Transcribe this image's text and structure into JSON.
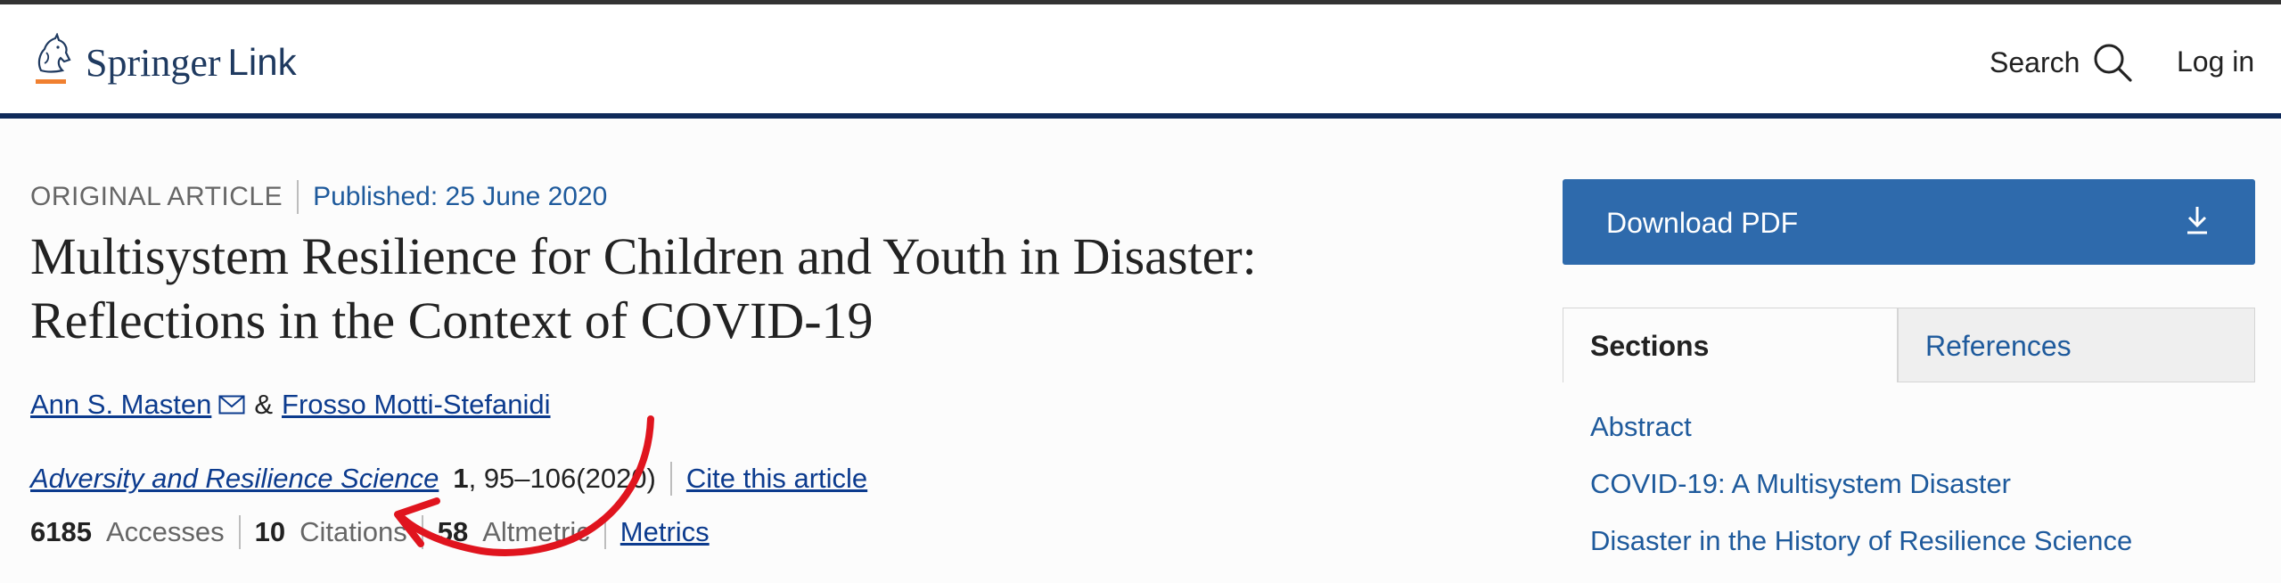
{
  "header": {
    "brand": "Springer",
    "brand_suffix": "Link",
    "search_label": "Search",
    "login_label": "Log in"
  },
  "article": {
    "type": "ORIGINAL ARTICLE",
    "published": "Published: 25 June 2020",
    "title": "Multisystem Resilience for Children and Youth in Disaster: Reflections in the Context of COVID-19",
    "authors": [
      {
        "name": "Ann S. Masten"
      },
      {
        "name": "Frosso Motti-Stefanidi"
      }
    ],
    "author_separator": "&",
    "journal": "Adversity and Resilience Science",
    "volume": "1",
    "pages_year": ", 95–106(2020)",
    "cite_label": "Cite this article",
    "metrics": {
      "accesses": "6185",
      "accesses_label": "Accesses",
      "citations": "10",
      "citations_label": "Citations",
      "altmetric": "58",
      "altmetric_label": "Altmetric",
      "metrics_link": "Metrics"
    }
  },
  "sidebar": {
    "download_label": "Download PDF",
    "tabs": [
      {
        "label": "Sections"
      },
      {
        "label": "References"
      }
    ],
    "sections": [
      {
        "label": "Abstract"
      },
      {
        "label": "COVID-19: A Multisystem Disaster"
      },
      {
        "label": "Disaster in the History of Resilience Science"
      }
    ]
  },
  "colors": {
    "header_rule": "#0f2a5a",
    "download_button": "#2e6aac",
    "link_blue": "#1e5a9c",
    "annotation_red": "#e0141e"
  },
  "icons": [
    "springer-horse-logo",
    "search-icon",
    "mail-icon",
    "download-icon"
  ]
}
